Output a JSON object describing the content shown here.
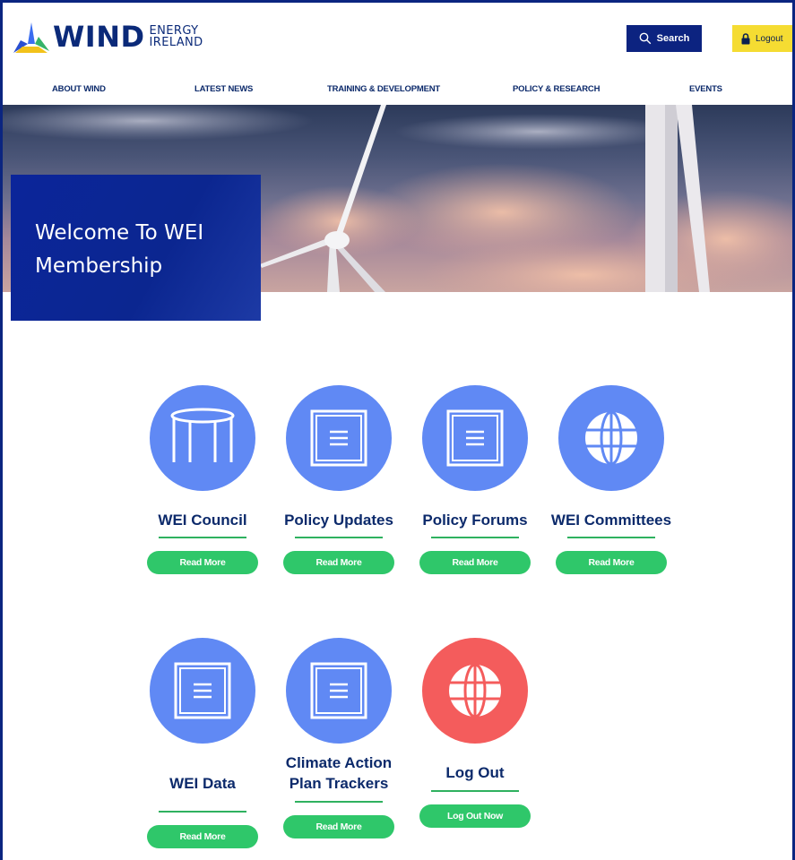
{
  "brand": {
    "word": "WIND",
    "sub_line1": "ENERGY",
    "sub_line2": "IRELAND"
  },
  "header": {
    "search_label": "Search",
    "logout_label": "Logout"
  },
  "nav": [
    {
      "label": "ABOUT WIND"
    },
    {
      "label": "LATEST NEWS"
    },
    {
      "label": "TRAINING & DEVELOPMENT"
    },
    {
      "label": "POLICY & RESEARCH"
    },
    {
      "label": "EVENTS"
    }
  ],
  "hero": {
    "title": "Welcome To WEI Membership"
  },
  "colors": {
    "navy": "#0c2380",
    "accent_blue": "#6089f4",
    "accent_red": "#f45c5c",
    "green": "#2fc76a",
    "yellow": "#f5dc32"
  },
  "cards": [
    {
      "title": "WEI Council",
      "button": "Read More",
      "icon": "table-icon"
    },
    {
      "title": "Policy Updates",
      "button": "Read More",
      "icon": "document-icon"
    },
    {
      "title": "Policy Forums",
      "button": "Read More",
      "icon": "document-icon"
    },
    {
      "title": "WEI Committees",
      "button": "Read More",
      "icon": "globe-icon"
    },
    {
      "title": "WEI Data",
      "button": "Read More",
      "icon": "document-icon"
    },
    {
      "title": "Climate Action Plan Trackers",
      "button": "Read More",
      "icon": "document-icon"
    },
    {
      "title": "Log Out",
      "button": "Log Out Now",
      "icon": "globe-icon"
    }
  ]
}
